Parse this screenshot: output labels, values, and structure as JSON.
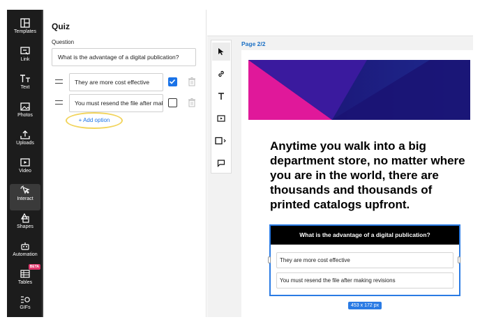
{
  "sidebar": {
    "items": [
      {
        "label": "Templates",
        "icon": "templates-icon"
      },
      {
        "label": "Link",
        "icon": "link-icon"
      },
      {
        "label": "Text",
        "icon": "text-icon"
      },
      {
        "label": "Photos",
        "icon": "photos-icon"
      },
      {
        "label": "Uploads",
        "icon": "uploads-icon"
      },
      {
        "label": "Video",
        "icon": "video-icon"
      },
      {
        "label": "Interact",
        "icon": "interact-icon",
        "active": true
      },
      {
        "label": "Shapes",
        "icon": "shapes-icon"
      },
      {
        "label": "Automation",
        "icon": "automation-icon"
      },
      {
        "label": "Tables",
        "icon": "tables-icon",
        "badge": "BETA"
      },
      {
        "label": "GIFs",
        "icon": "gifs-icon"
      }
    ]
  },
  "quiz_panel": {
    "title": "Quiz",
    "question_label": "Question",
    "question_value": "What is the advantage of a digital publication?",
    "options": [
      {
        "value": "They are more cost effective",
        "checked": true
      },
      {
        "value": "You must resend the file after making revisions",
        "checked": false
      }
    ],
    "add_option": "+ Add option"
  },
  "canvas": {
    "page_label": "Page 2/2",
    "headline": "Anytime you walk into a big department store, no matter where you are in the world, there are thousands and thousands of printed catalogs upfront.",
    "quiz_widget": {
      "question": "What is the advantage of a digital publication?",
      "options": [
        "They are more cost effective",
        "You must resend the file after making revisions"
      ]
    },
    "size_label": "453 x 172 px"
  },
  "colors": {
    "accent": "#1a73e8",
    "sidebar_bg": "#1c1c1c",
    "highlight_ring": "#f2d45c",
    "banner_magenta": "#e0189a",
    "banner_navy": "#1c0f7a"
  }
}
